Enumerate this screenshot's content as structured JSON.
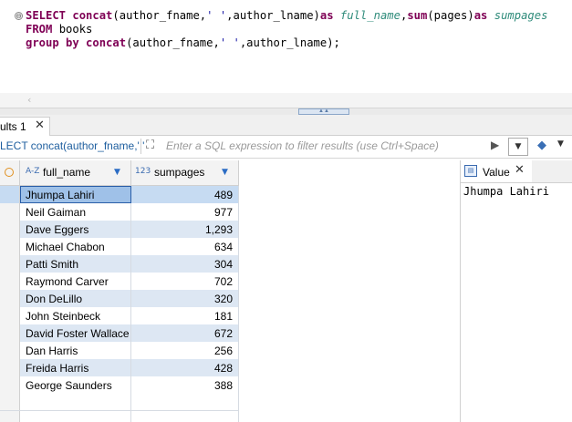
{
  "editor": {
    "fold_marker": "⊖",
    "line1": {
      "select": "SELECT",
      "concat1": "concat",
      "args1_a": "(author_fname,",
      "args1_str": "' '",
      "args1_b": ",author_lname)",
      "as1": "as",
      "alias1": "full_name",
      "comma": ",",
      "sum": "sum",
      "sum_args": "(pages)",
      "as2": "as",
      "alias2": "sumpages"
    },
    "line2": {
      "from": "FROM",
      "table": "books"
    },
    "line3": {
      "group_by": "group by",
      "concat2": "concat",
      "args2_a": "(author_fname,",
      "args2_str": "' '",
      "args2_b": ",author_lname);"
    }
  },
  "hscroll": {
    "left_arrow": "‹"
  },
  "results_tab": {
    "label": "ults 1",
    "close": "✕"
  },
  "filter": {
    "sql_prefix": "LECT concat(author_fname,' '",
    "expand_icon_glyph": "⛶",
    "placeholder": "Enter a SQL expression to filter results (use Ctrl+Space)",
    "play_glyph": "▶",
    "history_glyph": "▼",
    "erase_glyph": "◆",
    "dropdown_glyph": "▼"
  },
  "grid": {
    "columns": [
      {
        "type_icon": "A-Z",
        "name": "full_name",
        "sort_glyph": "▼"
      },
      {
        "type_icon": "123",
        "name": "sumpages",
        "sort_glyph": "▼"
      }
    ],
    "rows": [
      {
        "full_name": "Jhumpa Lahiri",
        "sumpages": "489"
      },
      {
        "full_name": "Neil Gaiman",
        "sumpages": "977"
      },
      {
        "full_name": "Dave Eggers",
        "sumpages": "1,293"
      },
      {
        "full_name": "Michael Chabon",
        "sumpages": "634"
      },
      {
        "full_name": "Patti Smith",
        "sumpages": "304"
      },
      {
        "full_name": "Raymond Carver",
        "sumpages": "702"
      },
      {
        "full_name": "Don DeLillo",
        "sumpages": "320"
      },
      {
        "full_name": "John Steinbeck",
        "sumpages": "181"
      },
      {
        "full_name": "David Foster Wallace",
        "sumpages": "672"
      },
      {
        "full_name": "Dan Harris",
        "sumpages": "256"
      },
      {
        "full_name": "Freida Harris",
        "sumpages": "428"
      },
      {
        "full_name": "George Saunders",
        "sumpages": "388"
      }
    ],
    "selected_row": 0
  },
  "value_panel": {
    "tab_label": "Value",
    "icon_glyph": "▤",
    "close": "✕",
    "content": "Jhumpa Lahiri"
  }
}
